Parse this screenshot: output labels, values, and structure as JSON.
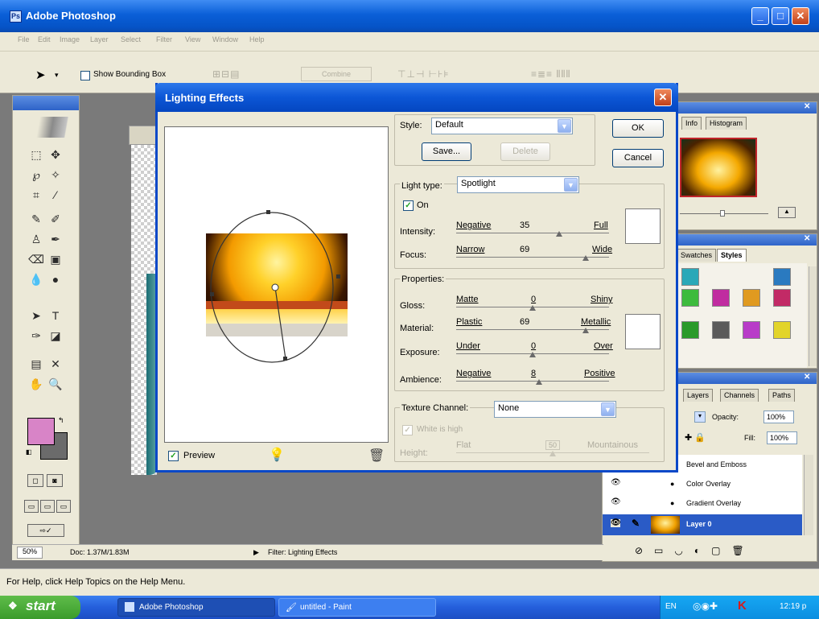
{
  "app": {
    "title": "Adobe Photoshop"
  },
  "menu": [
    "File",
    "Edit",
    "Image",
    "Layer",
    "Select",
    "Filter",
    "View",
    "Window",
    "Help"
  ],
  "options_bar": {
    "show_bounding_box_label": "Show Bounding Box",
    "combine_label": "Combine"
  },
  "status_bar": {
    "zoom": "50%",
    "doc_size": "Doc: 1.37M/1.83M",
    "filter_label": "Filter: Lighting Effects"
  },
  "help_text": "For Help, click Help Topics on the Help Menu.",
  "navigator": {
    "tabs": [
      "Info",
      "Histogram"
    ]
  },
  "styles_panel": {
    "tabs": [
      "Swatches",
      "Styles"
    ]
  },
  "layers_panel": {
    "tabs": [
      "Layers",
      "Channels",
      "Paths"
    ],
    "opacity_label": "Opacity:",
    "opacity_value": "100%",
    "fill_label": "Fill:",
    "fill_value": "100%",
    "effects": [
      "Bevel and Emboss",
      "Color Overlay",
      "Gradient Overlay"
    ],
    "layer_name": "Layer 0"
  },
  "dialog": {
    "title": "Lighting Effects",
    "style_label": "Style:",
    "style_value": "Default",
    "save_label": "Save...",
    "delete_label": "Delete",
    "ok_label": "OK",
    "cancel_label": "Cancel",
    "light_type_label": "Light type:",
    "light_type_value": "Spotlight",
    "on_label": "On",
    "intensity": {
      "label": "Intensity:",
      "min": "Negative",
      "value": "35",
      "max": "Full"
    },
    "focus": {
      "label": "Focus:",
      "min": "Narrow",
      "value": "69",
      "max": "Wide"
    },
    "properties_label": "Properties:",
    "gloss": {
      "label": "Gloss:",
      "min": "Matte",
      "value": "0",
      "max": "Shiny"
    },
    "material": {
      "label": "Material:",
      "min": "Plastic",
      "value": "69",
      "max": "Metallic"
    },
    "exposure": {
      "label": "Exposure:",
      "min": "Under",
      "value": "0",
      "max": "Over"
    },
    "ambience": {
      "label": "Ambience:",
      "min": "Negative",
      "value": "8",
      "max": "Positive"
    },
    "texture_channel_label": "Texture Channel:",
    "texture_channel_value": "None",
    "white_is_high_label": "White is high",
    "height": {
      "label": "Height:",
      "min": "Flat",
      "value": "50",
      "max": "Mountainous"
    },
    "preview_label": "Preview"
  },
  "taskbar": {
    "start_label": "start",
    "tasks": [
      "Adobe Photoshop",
      "untitled - Paint"
    ],
    "lang": "EN",
    "clock": "12:19 p"
  },
  "colors": {
    "xp_blue": "#0a5fd8",
    "dialog_bg": "#ece9d8",
    "foreground_color": "#d884c7",
    "background_color": "#6b6b6b"
  }
}
